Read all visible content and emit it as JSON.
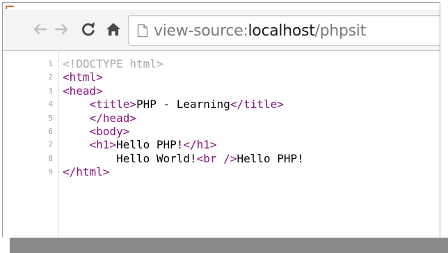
{
  "browser": {
    "url_prefix": "view-source:",
    "url_host": "localhost",
    "url_path": "/phpsit",
    "nav_icons": {
      "back": "arrow-left-icon",
      "forward": "arrow-right-icon",
      "reload": "reload-icon",
      "home": "home-icon",
      "page": "page-icon"
    }
  },
  "source": {
    "lines": [
      {
        "n": "1",
        "parts": [
          {
            "t": "<!DOCTYPE html>",
            "c": "doctype"
          }
        ]
      },
      {
        "n": "2",
        "parts": [
          {
            "t": "<html>",
            "c": "tag"
          }
        ]
      },
      {
        "n": "3",
        "parts": [
          {
            "t": "<head>",
            "c": "tag"
          }
        ]
      },
      {
        "n": "4",
        "parts": [
          {
            "t": "    ",
            "c": "text"
          },
          {
            "t": "<title>",
            "c": "tag"
          },
          {
            "t": "PHP - Learning",
            "c": "text"
          },
          {
            "t": "</title>",
            "c": "tag"
          }
        ]
      },
      {
        "n": "5",
        "parts": [
          {
            "t": "    ",
            "c": "text"
          },
          {
            "t": "</head>",
            "c": "tag"
          }
        ]
      },
      {
        "n": "6",
        "parts": [
          {
            "t": "    ",
            "c": "text"
          },
          {
            "t": "<body>",
            "c": "tag"
          }
        ]
      },
      {
        "n": "7",
        "parts": [
          {
            "t": "    ",
            "c": "text"
          },
          {
            "t": "<h1>",
            "c": "tag"
          },
          {
            "t": "Hello PHP!",
            "c": "text"
          },
          {
            "t": "</h1>",
            "c": "tag"
          }
        ]
      },
      {
        "n": "8",
        "parts": [
          {
            "t": "        Hello World!",
            "c": "text"
          },
          {
            "t": "<br />",
            "c": "tag"
          },
          {
            "t": "Hello PHP!",
            "c": "text"
          }
        ]
      },
      {
        "n": "9",
        "parts": [
          {
            "t": "</html>",
            "c": "tag"
          }
        ]
      }
    ]
  }
}
